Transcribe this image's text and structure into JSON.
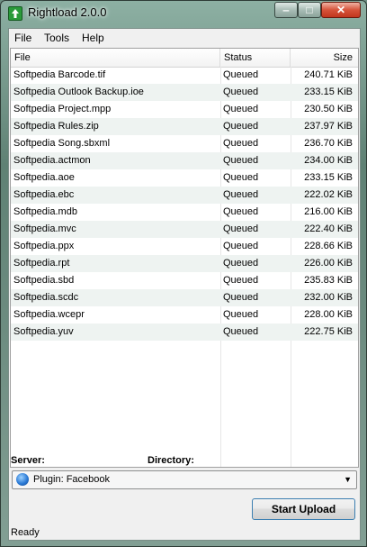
{
  "window": {
    "title": "Rightload 2.0.0",
    "minimize": "‒",
    "maximize": "□",
    "close": "✕"
  },
  "menu": [
    "File",
    "Tools",
    "Help"
  ],
  "list": {
    "columns": [
      "File",
      "Status",
      "Size"
    ],
    "rows": [
      [
        "Softpedia Barcode.tif",
        "Queued",
        "240.71 KiB"
      ],
      [
        "Softpedia Outlook Backup.ioe",
        "Queued",
        "233.15 KiB"
      ],
      [
        "Softpedia Project.mpp",
        "Queued",
        "230.50 KiB"
      ],
      [
        "Softpedia Rules.zip",
        "Queued",
        "237.97 KiB"
      ],
      [
        "Softpedia Song.sbxml",
        "Queued",
        "236.70 KiB"
      ],
      [
        "Softpedia.actmon",
        "Queued",
        "234.00 KiB"
      ],
      [
        "Softpedia.aoe",
        "Queued",
        "233.15 KiB"
      ],
      [
        "Softpedia.ebc",
        "Queued",
        "222.02 KiB"
      ],
      [
        "Softpedia.mdb",
        "Queued",
        "216.00 KiB"
      ],
      [
        "Softpedia.mvc",
        "Queued",
        "222.40 KiB"
      ],
      [
        "Softpedia.ppx",
        "Queued",
        "228.66 KiB"
      ],
      [
        "Softpedia.rpt",
        "Queued",
        "226.00 KiB"
      ],
      [
        "Softpedia.sbd",
        "Queued",
        "235.83 KiB"
      ],
      [
        "Softpedia.scdc",
        "Queued",
        "232.00 KiB"
      ],
      [
        "Softpedia.wcepr",
        "Queued",
        "228.00 KiB"
      ],
      [
        "Softpedia.yuv",
        "Queued",
        "222.75 KiB"
      ]
    ]
  },
  "labels": {
    "server": "Server:",
    "directory": "Directory:"
  },
  "server_select": {
    "value": "Plugin: Facebook",
    "icon": "globe-icon"
  },
  "buttons": {
    "start_upload": "Start Upload"
  },
  "statusbar": {
    "text": "Ready"
  },
  "colors": {
    "title_green": "#2a9a3a",
    "close_red": "#c1361e"
  }
}
